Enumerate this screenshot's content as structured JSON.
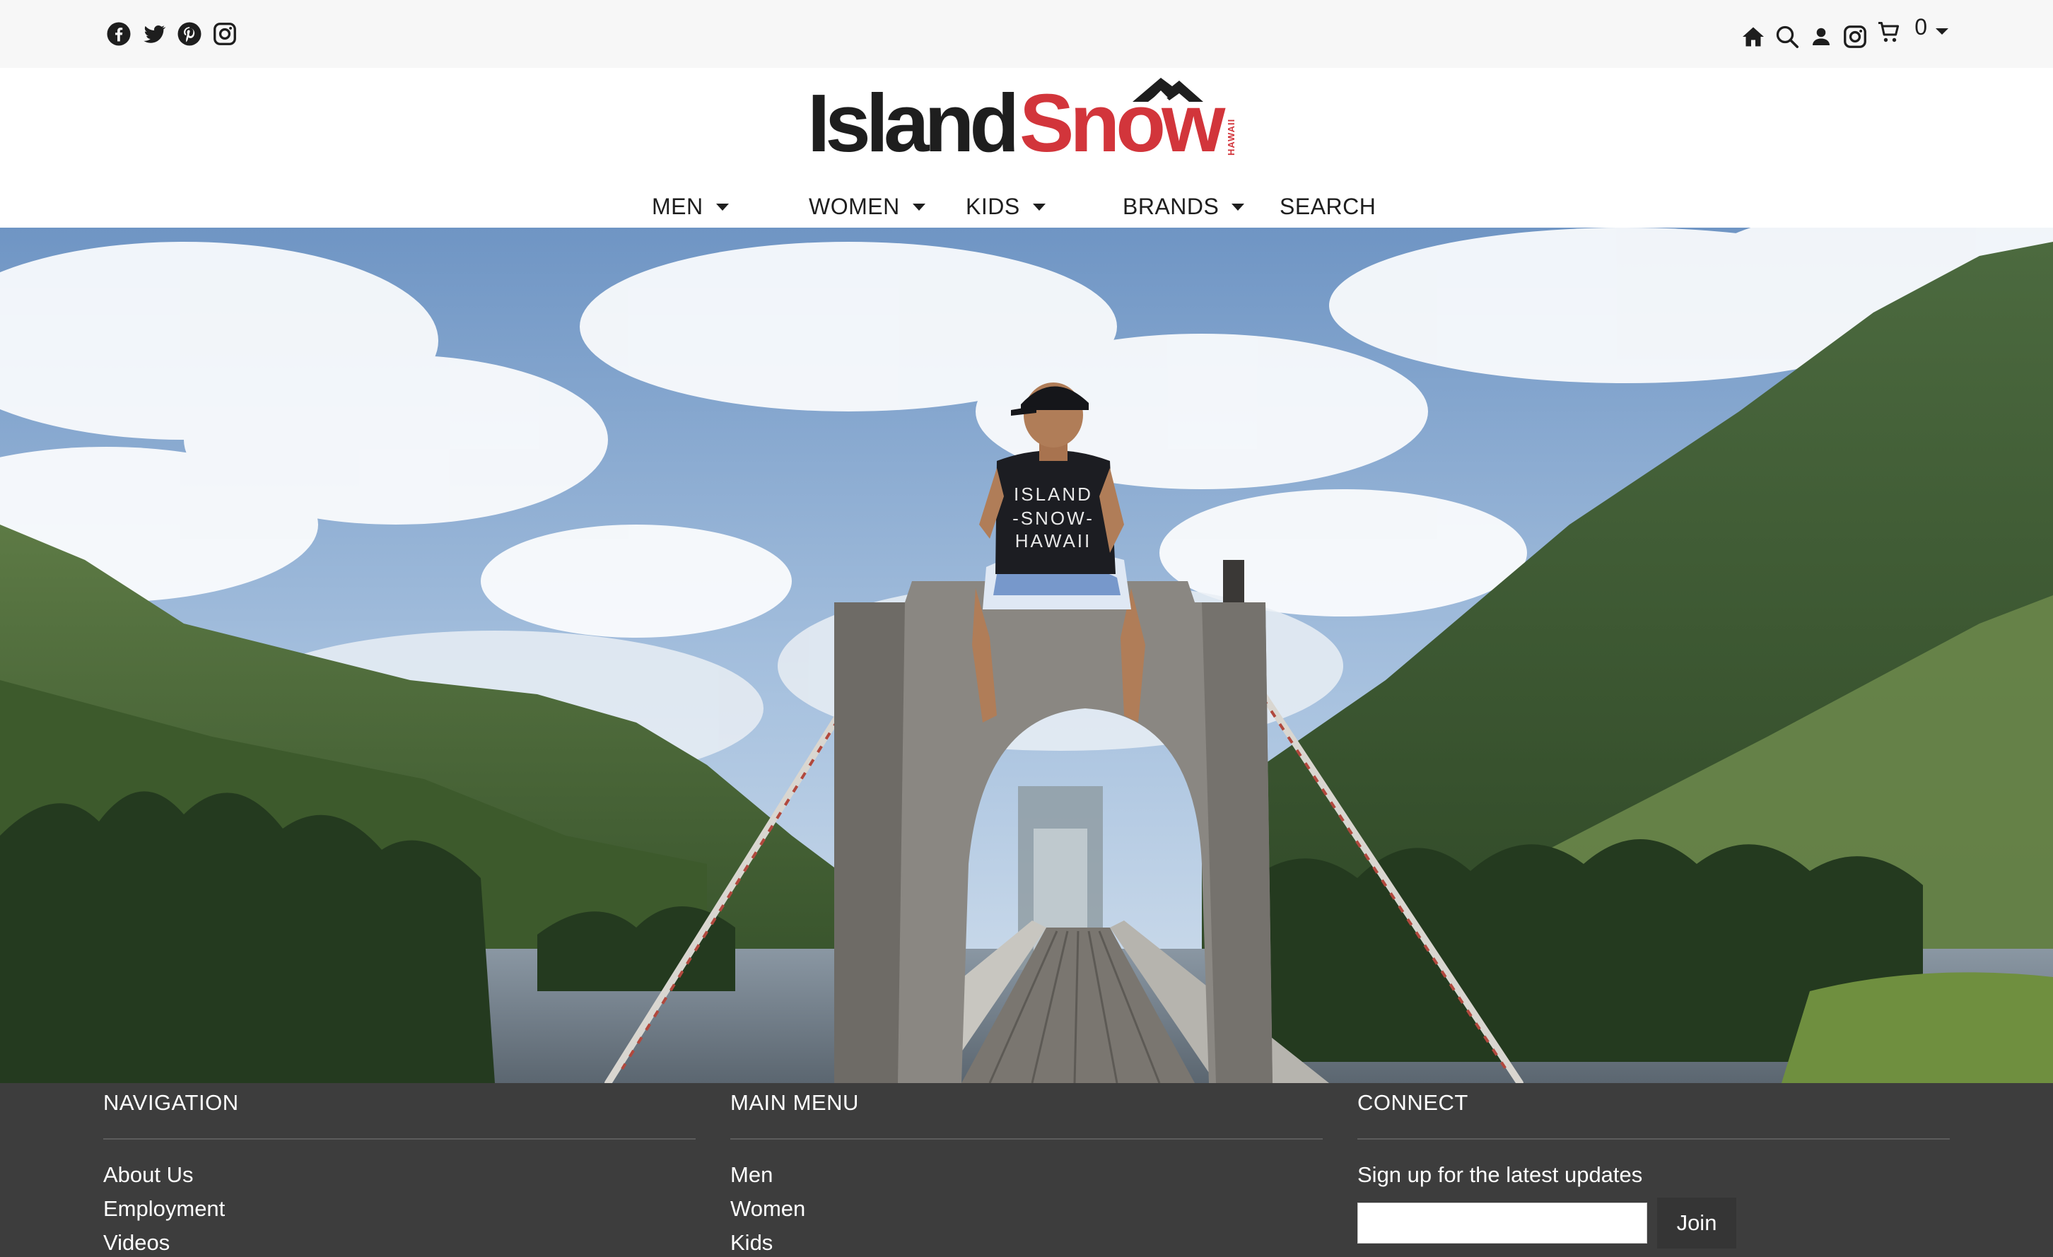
{
  "social": {
    "icons": [
      "facebook-icon",
      "twitter-icon",
      "pinterest-icon",
      "instagram-icon"
    ]
  },
  "utility": {
    "icons": [
      "home-icon",
      "search-icon",
      "account-icon",
      "instagram-icon",
      "cart-icon"
    ],
    "cart_count": "0"
  },
  "brand": {
    "logo_word_1": "Island",
    "logo_word_2": "Snow",
    "logo_small": "HAWAII",
    "color_dark": "#1e1e1e",
    "color_red": "#d2353b"
  },
  "nav": {
    "items": [
      {
        "label": "MEN",
        "has_dropdown": true
      },
      {
        "label": "WOMEN",
        "has_dropdown": true
      },
      {
        "label": "KIDS",
        "has_dropdown": true
      },
      {
        "label": "BRANDS",
        "has_dropdown": true
      },
      {
        "label": "SEARCH",
        "has_dropdown": false
      }
    ]
  },
  "hero": {
    "shirt_text": [
      "ISLAND",
      "-SNOW-",
      "HAWAII"
    ]
  },
  "footer": {
    "navigation": {
      "title": "NAVIGATION",
      "links": [
        "About Us",
        "Employment",
        "Videos"
      ]
    },
    "main_menu": {
      "title": "MAIN MENU",
      "links": [
        "Men",
        "Women",
        "Kids"
      ]
    },
    "connect": {
      "title": "CONNECT",
      "signup_text": "Sign up for the latest updates",
      "input_value": "",
      "join_label": "Join"
    }
  }
}
